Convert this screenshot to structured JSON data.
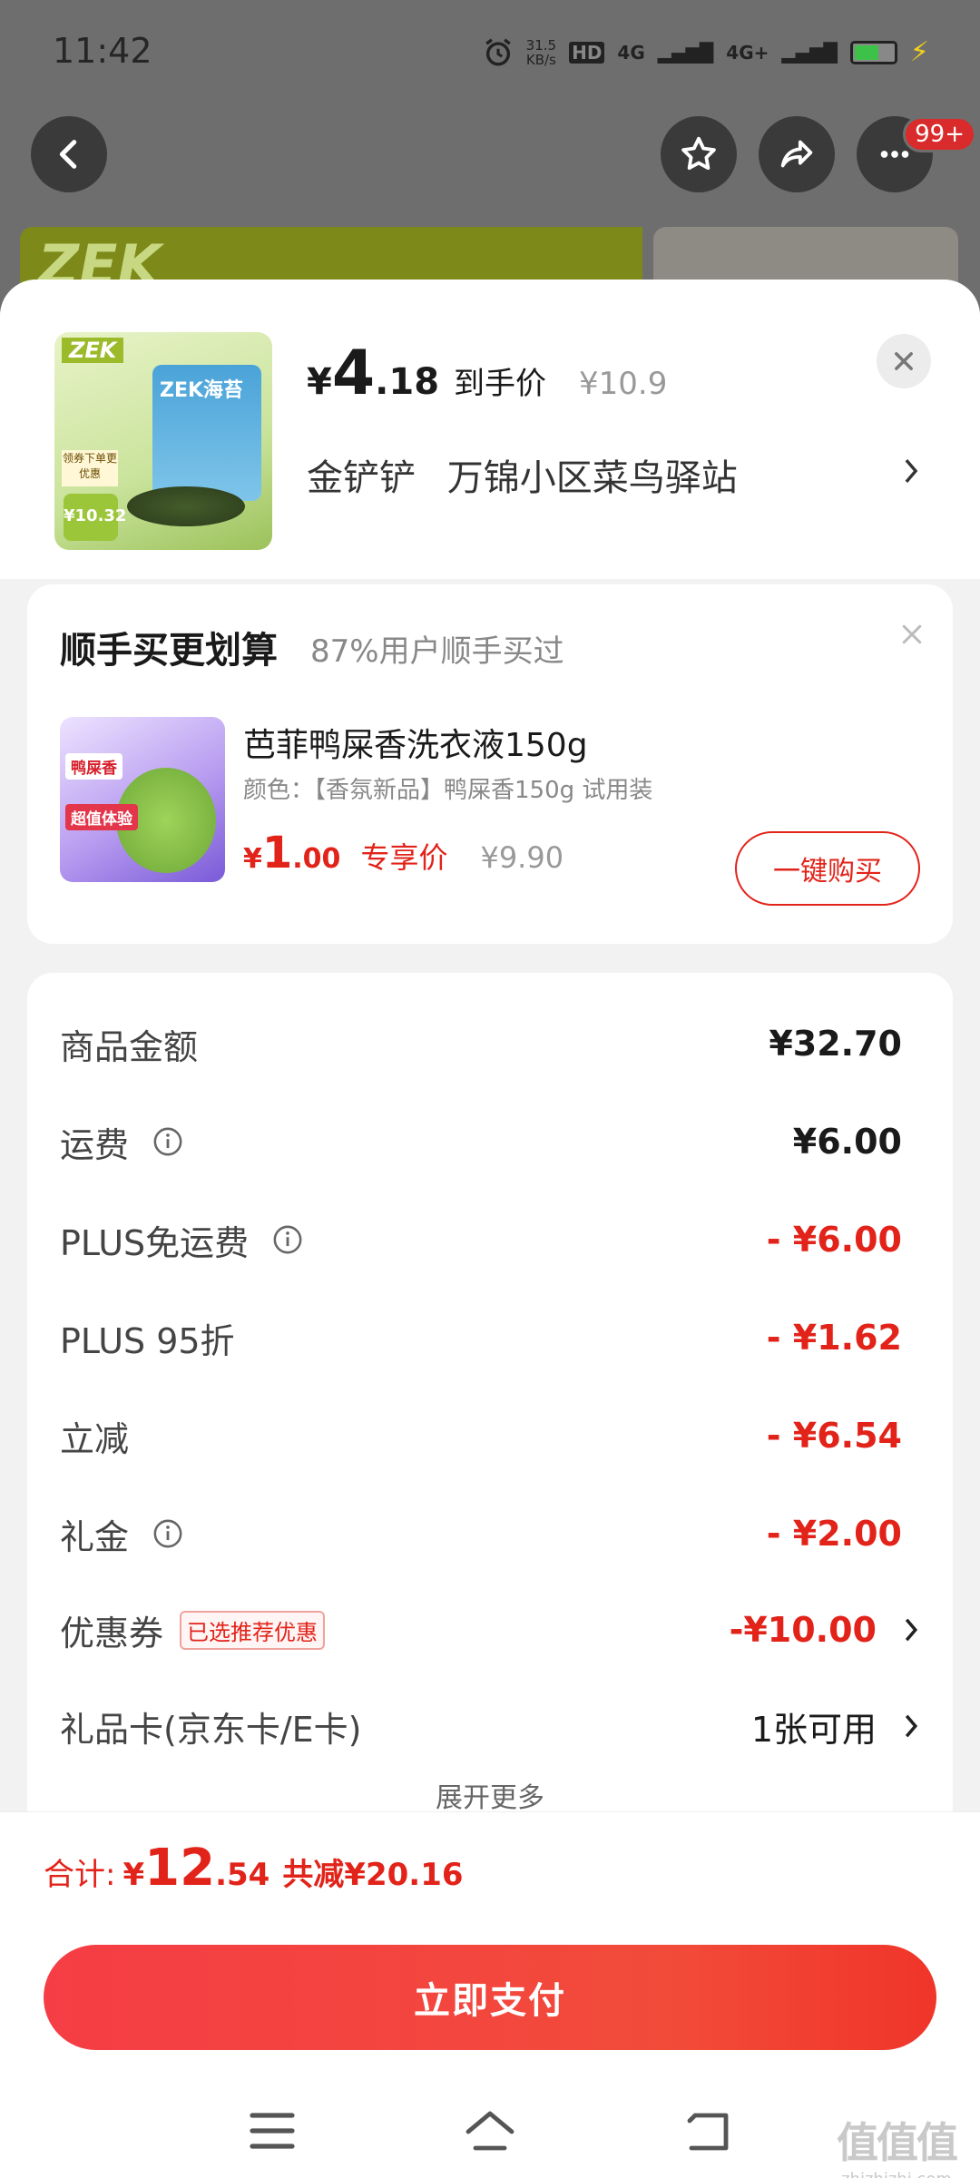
{
  "status_bar": {
    "time": "11:42",
    "net_speed": "31.5",
    "net_unit": "KB/s",
    "hd": "HD",
    "sig1": "4G",
    "sig2": "4G+"
  },
  "top_nav": {
    "badge": "99+",
    "banner_text": "ZEK"
  },
  "product": {
    "price_currency": "¥",
    "price_int": "4",
    "price_dec": ".18",
    "price_label": "到手价",
    "original_price": "¥10.9",
    "image_logo": "ZEK",
    "image_bag_text": "ZEK海苔",
    "image_tag": "领券下单更优惠",
    "image_price": "¥10.32",
    "pickup_name": "金铲铲",
    "pickup_address": "万锦小区菜鸟驿站"
  },
  "addon": {
    "title": "顺手买更划算",
    "subtitle": "87%用户顺手买过",
    "item_name": "芭菲鸭屎香洗衣液150g",
    "item_spec": "颜色：【香氛新品】鸭屎香150g 试用装",
    "image_label": "鸭屎香",
    "image_label2": "超值体验",
    "price_currency": "¥",
    "price_int": "1",
    "price_dec": ".00",
    "price_tag": "专享价",
    "original_price": "¥9.90",
    "buy_button": "一键购买"
  },
  "summary": {
    "rows": [
      {
        "label": "商品金额",
        "value": "¥32.70"
      },
      {
        "label": "运费",
        "value": "¥6.00"
      },
      {
        "label": "PLUS免运费",
        "value": "- ¥6.00"
      },
      {
        "label": "PLUS 95折",
        "value": "- ¥1.62"
      },
      {
        "label": "立减",
        "value": "- ¥6.54"
      },
      {
        "label": "礼金",
        "value": "- ¥2.00"
      },
      {
        "label": "优惠券",
        "tag": "已选推荐优惠",
        "value": "-¥10.00"
      },
      {
        "label": "礼品卡(京东卡/E卡)",
        "value": "1张可用"
      }
    ],
    "more": "展开更多"
  },
  "bottom": {
    "total_label": "合计:",
    "total_currency": "¥",
    "total_int": "12",
    "total_dec": ".54",
    "saved": "共减¥20.16",
    "pay_button": "立即支付"
  },
  "watermark": {
    "big": "值值值",
    "small": "zhizhizhi.com"
  },
  "colors": {
    "accent_red": "#e2231a",
    "pay_gradient_start": "#f53d45",
    "pay_gradient_end": "#f0352a"
  }
}
